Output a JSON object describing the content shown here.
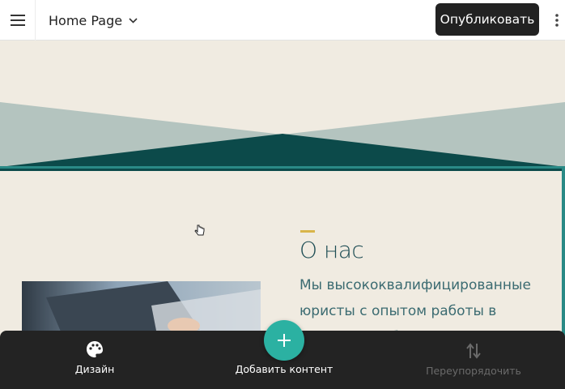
{
  "topbar": {
    "page_name": "Home Page",
    "publish_label": "Опубликовать"
  },
  "section": {
    "title": "О нас",
    "text": "Мы высококвалифицированные юристы с опытом работы в различных областях. Известные"
  },
  "bottombar": {
    "design_label": "Дизайн",
    "add_content_label": "Добавить контент",
    "reorder_label": "Переупорядочить"
  },
  "icons": {
    "menu": "hamburger-menu-icon",
    "chevron": "chevron-down-icon",
    "more": "more-vertical-icon",
    "design": "palette-icon",
    "add": "plus-icon",
    "reorder": "swap-vertical-icon"
  },
  "colors": {
    "page_background": "#f0ebe1",
    "hero_light": "#b4c4bf",
    "hero_dark": "#0c4a4a",
    "selection": "#2a8a86",
    "accent": "#d9b54a",
    "title": "#1f4e55",
    "text": "#3b6b71",
    "bar_dark": "#232323",
    "fab": "#2bb1a2"
  }
}
